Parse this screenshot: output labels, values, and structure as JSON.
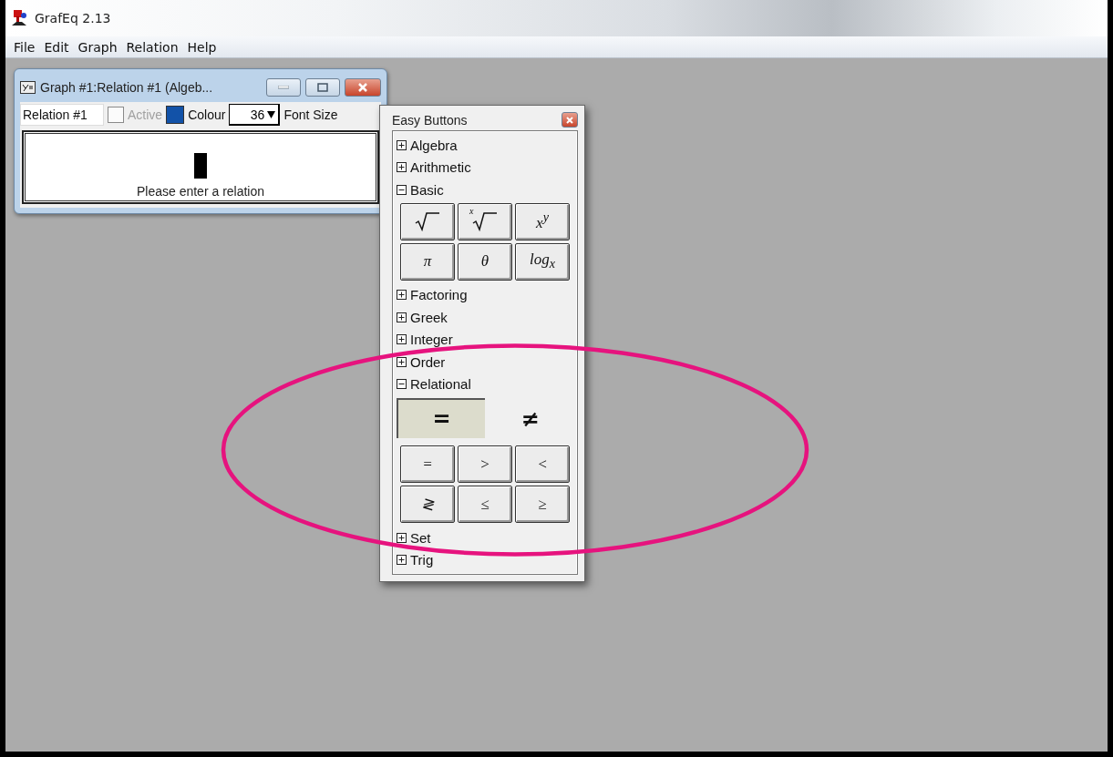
{
  "window": {
    "title": "GrafEq 2.13"
  },
  "menu": [
    "File",
    "Edit",
    "Graph",
    "Relation",
    "Help"
  ],
  "graph_window": {
    "title": "Graph #1:Relation #1 (Algeb...",
    "name_field": {
      "value": "Relation #1"
    },
    "active": {
      "label": "Active",
      "checked": false,
      "disabled": true
    },
    "colour": {
      "label": "Colour",
      "color": "#1252a8"
    },
    "font_size": {
      "value": "36",
      "label": "Font Size"
    },
    "editor": {
      "hint": "Please enter a relation"
    }
  },
  "easy_buttons": {
    "title": "Easy Buttons",
    "sections": [
      {
        "label": "Algebra",
        "expanded": false
      },
      {
        "label": "Arithmetic",
        "expanded": false
      },
      {
        "label": "Basic",
        "expanded": true,
        "buttons": [
          {
            "kind": "root"
          },
          {
            "kind": "root",
            "index": "x"
          },
          {
            "kind": "text",
            "label": "x$^{y}$"
          },
          {
            "kind": "text",
            "label": "π"
          },
          {
            "kind": "text",
            "label": "θ"
          },
          {
            "kind": "text",
            "label": "log$_{x}$"
          }
        ]
      },
      {
        "label": "Factoring",
        "expanded": false
      },
      {
        "label": "Greek",
        "expanded": false
      },
      {
        "label": "Integer",
        "expanded": false
      },
      {
        "label": "Order",
        "expanded": false
      },
      {
        "label": "Relational",
        "expanded": true,
        "options": [
          {
            "label": "=",
            "selected": true
          },
          {
            "label": "≠",
            "selected": false
          }
        ],
        "buttons": [
          {
            "kind": "text",
            "label": "="
          },
          {
            "kind": "text",
            "label": ">"
          },
          {
            "kind": "text",
            "label": "<"
          },
          {
            "kind": "text",
            "label": "≷"
          },
          {
            "kind": "text",
            "label": "≤"
          },
          {
            "kind": "text",
            "label": "≥"
          }
        ]
      },
      {
        "label": "Set",
        "expanded": false
      },
      {
        "label": "Trig",
        "expanded": false
      }
    ]
  }
}
